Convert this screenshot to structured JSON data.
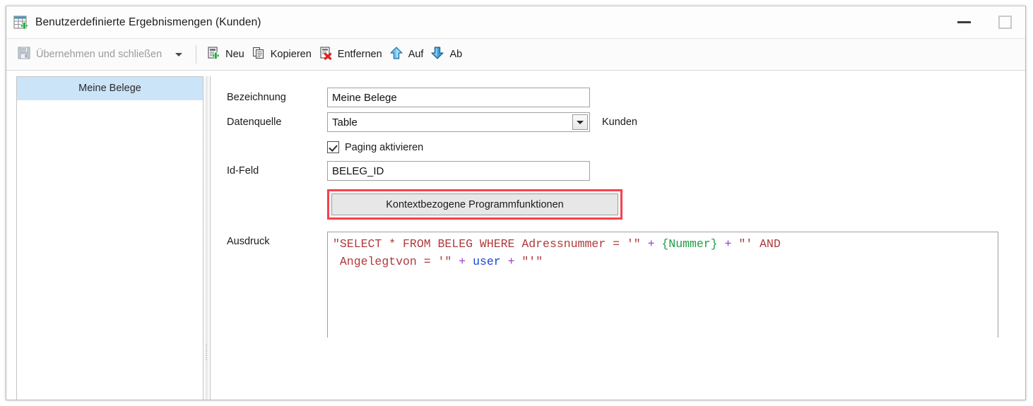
{
  "window": {
    "title": "Benutzerdefinierte Ergebnismengen (Kunden)",
    "icon": "table-add-icon",
    "minimize_label": "—",
    "maximize_label": "□"
  },
  "toolbar": {
    "apply_close": {
      "label": "Übernehmen und schließen",
      "icon": "save-icon",
      "disabled": true
    },
    "dropdown_icon": "chevron-down-icon",
    "items": [
      {
        "label": "Neu",
        "icon": "new-record-icon"
      },
      {
        "label": "Kopieren",
        "icon": "copy-icon"
      },
      {
        "label": "Entfernen",
        "icon": "delete-icon"
      },
      {
        "label": "Auf",
        "icon": "arrow-up-icon"
      },
      {
        "label": "Ab",
        "icon": "arrow-down-icon"
      }
    ]
  },
  "list": {
    "items": [
      {
        "label": "Meine Belege",
        "selected": true
      }
    ]
  },
  "form": {
    "bezeichnung": {
      "label": "Bezeichnung",
      "value": "Meine Belege"
    },
    "datenquelle": {
      "label": "Datenquelle",
      "value": "Table",
      "side_text": "Kunden"
    },
    "paging": {
      "label": "Paging aktivieren",
      "checked": true
    },
    "id_feld": {
      "label": "Id-Feld",
      "value": "BELEG_ID"
    },
    "context_button": {
      "label": "Kontextbezogene Programmfunktionen",
      "highlight_color": "#f6414c"
    },
    "ausdruck": {
      "label": "Ausdruck",
      "value": "\"SELECT * FROM BELEG WHERE Adressnummer = '\" + {Nummer} + \"' AND Angelegtvon = '\" + user + \"'\"",
      "tokens": [
        {
          "text": "\"SELECT * FROM BELEG WHERE Adressnummer = '\"",
          "type": "string"
        },
        {
          "text": " + ",
          "type": "operator"
        },
        {
          "text": "{Nummer}",
          "type": "placeholder"
        },
        {
          "text": " + ",
          "type": "operator"
        },
        {
          "text": "\"' AND\n Angelegtvon = '\"",
          "type": "string"
        },
        {
          "text": " + ",
          "type": "operator"
        },
        {
          "text": "user",
          "type": "variable"
        },
        {
          "text": " + ",
          "type": "operator"
        },
        {
          "text": "\"'\"",
          "type": "string"
        }
      ],
      "colors": {
        "string": "#b03a3a",
        "operator": "#9a3fd0",
        "variable": "#1a46d8",
        "placeholder": "#1f9d44"
      }
    }
  }
}
